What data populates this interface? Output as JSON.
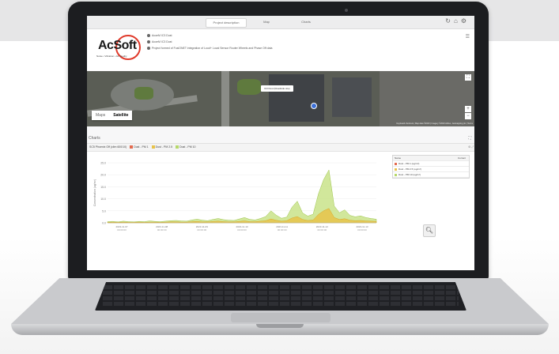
{
  "topbar": {
    "tabs": [
      {
        "label": "Project description",
        "active": true
      },
      {
        "label": "Map",
        "active": false
      },
      {
        "label": "Charts",
        "active": false
      }
    ]
  },
  "header": {
    "logo": {
      "brand": "AcSoft",
      "tagline": "Noise • Vibration • Air Quality"
    },
    "info_lines": [
      "AcoeM IC3 Dust",
      "AcoeM IC3 Dust",
      "Project formed of FusiONET integration of Loud+ Local Sensor Router Wheels and Phase Off data"
    ]
  },
  "map": {
    "toggle": {
      "map_label": "Maps",
      "satellite_label": "Satellite"
    },
    "popup_text": "IC3 Dust (Roadside site)",
    "footer_text": "Keyboard shortcuts | Map data ©2023 | Imagery ©2023 Airbus, Getmapping plc | Terms"
  },
  "charts": {
    "section_label": "Charts",
    "panel_title": "SC5 Phoenix Off (clim 600/10)",
    "series": [
      {
        "name": "Dust - PM 1",
        "color": "#e36a4e"
      },
      {
        "name": "Dust - PM 2.5",
        "color": "#e8c34a"
      },
      {
        "name": "Dust - PM 10",
        "color": "#b6d86a"
      }
    ],
    "legend_table": {
      "header": [
        "Name",
        "Current"
      ],
      "rows": [
        "Dust - PM 1 (ug/m³)",
        "Dust - PM 2.5 (ug/m³)",
        "Dust - PM 10 (ug/m³)"
      ]
    }
  },
  "chart_data": {
    "type": "area",
    "ylabel": "Concentration (ug/m³)",
    "ylim": [
      0,
      25
    ],
    "y_ticks": [
      "25.0",
      "20.0",
      "15.0",
      "10.0",
      "5.0",
      "0.0"
    ],
    "x_ticks": [
      "2023-11-07",
      "2023-11-08",
      "2023-11-09",
      "2023-11-10",
      "2023-11-11",
      "2023-11-12",
      "2023-11-13"
    ],
    "x_ticks_sub": [
      "00:00:00",
      "00:00:00",
      "00:00:00",
      "00:00:00",
      "00:00:00",
      "00:00:00",
      "00:00:00"
    ],
    "series": [
      {
        "name": "Dust - PM 10",
        "values": [
          0.5,
          0.6,
          0.4,
          0.7,
          0.5,
          0.4,
          0.6,
          0.5,
          0.8,
          0.6,
          0.5,
          0.7,
          0.9,
          1.0,
          0.8,
          0.7,
          1.2,
          1.5,
          1.1,
          0.9,
          1.4,
          1.8,
          1.3,
          1.1,
          1.0,
          1.6,
          2.2,
          1.4,
          1.2,
          1.8,
          2.6,
          5.0,
          3.2,
          1.9,
          2.4,
          6.5,
          9.0,
          4.1,
          2.8,
          3.6,
          12.0,
          18.0,
          22.0,
          7.0,
          4.2,
          5.4,
          3.1,
          2.5,
          2.9,
          2.2,
          1.8,
          1.5
        ]
      },
      {
        "name": "Dust - PM 2.5",
        "values": [
          0.2,
          0.3,
          0.2,
          0.3,
          0.2,
          0.2,
          0.3,
          0.2,
          0.3,
          0.3,
          0.2,
          0.3,
          0.4,
          0.4,
          0.3,
          0.3,
          0.5,
          0.6,
          0.4,
          0.4,
          0.6,
          0.7,
          0.5,
          0.4,
          0.4,
          0.6,
          0.8,
          0.5,
          0.5,
          0.7,
          0.9,
          1.6,
          1.1,
          0.7,
          0.9,
          2.0,
          2.6,
          1.4,
          1.0,
          1.2,
          3.5,
          5.0,
          6.0,
          2.2,
          1.4,
          1.7,
          1.1,
          0.9,
          1.0,
          0.8,
          0.7,
          0.6
        ]
      }
    ]
  }
}
